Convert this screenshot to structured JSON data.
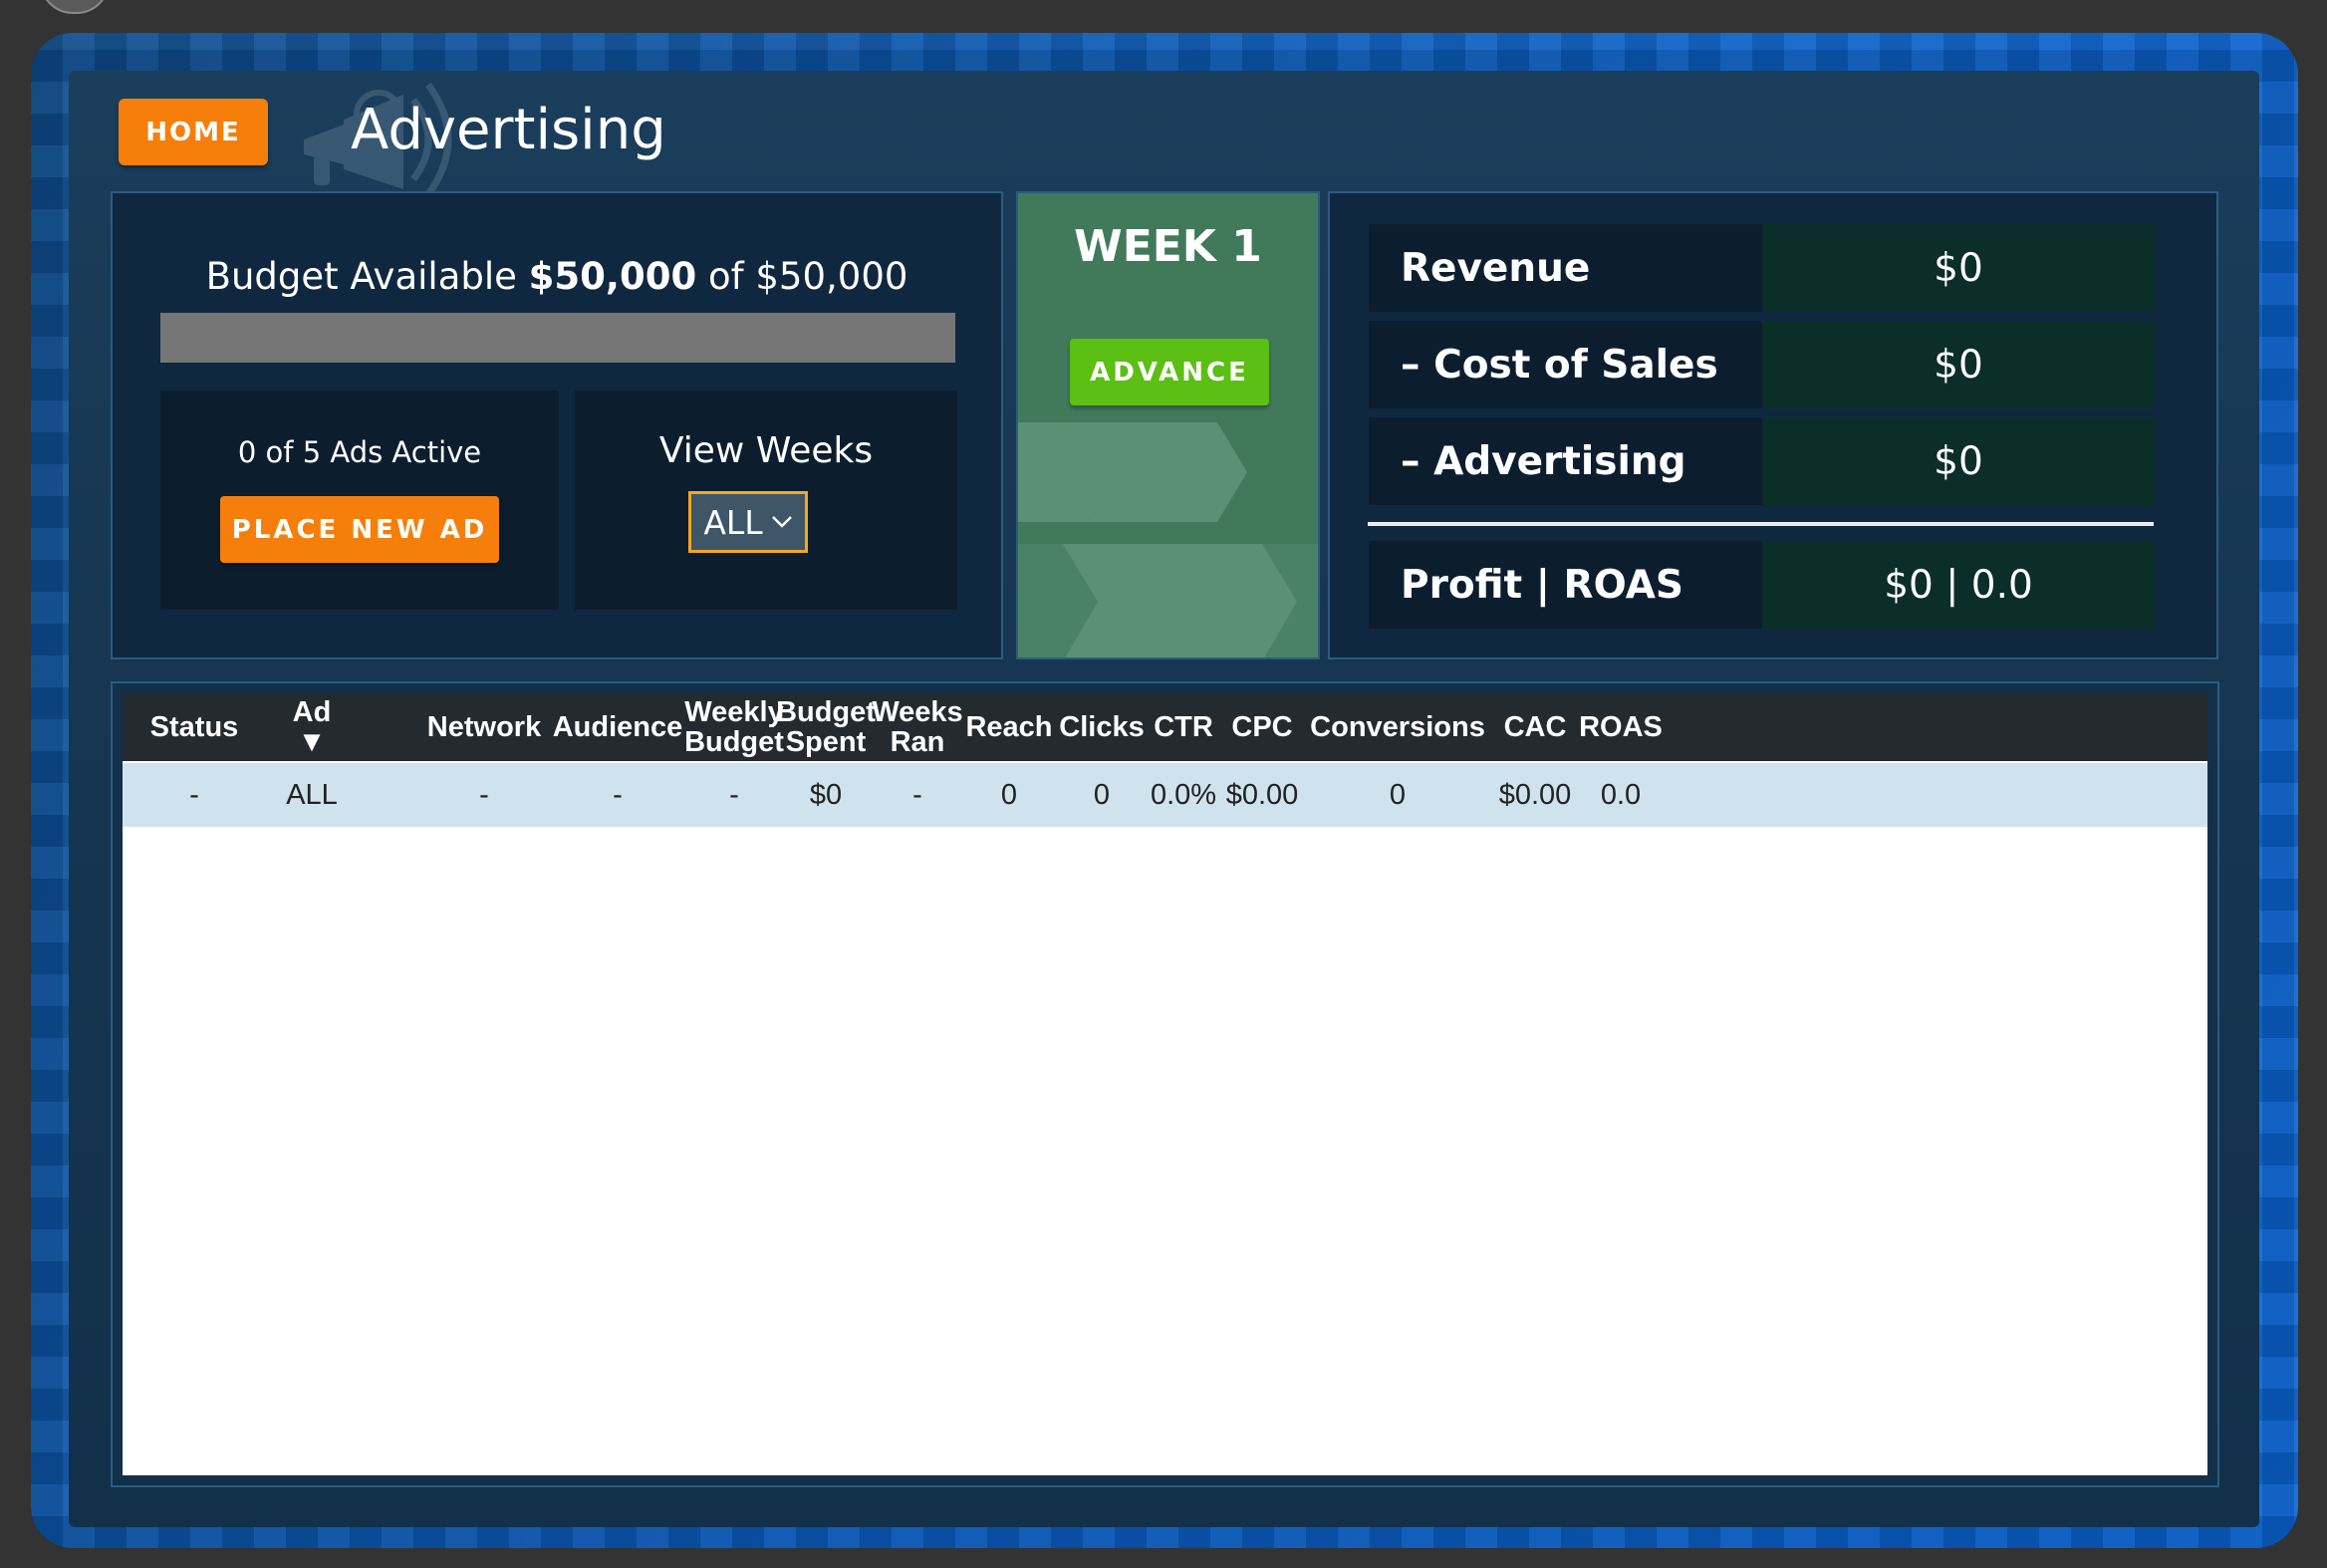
{
  "nav": {
    "home_label": "HOME"
  },
  "page": {
    "title": "Advertising"
  },
  "budget": {
    "prefix": "Budget Available",
    "available": "$50,000",
    "of_text": "of $50,000",
    "spent_fraction": 0
  },
  "ads": {
    "active_text": "0 of 5 Ads Active",
    "place_button_label": "PLACE NEW AD"
  },
  "view_weeks": {
    "label": "View Weeks",
    "selected": "ALL"
  },
  "week": {
    "title": "WEEK 1",
    "advance_label": "ADVANCE"
  },
  "financials": {
    "revenue": {
      "label": "Revenue",
      "value": "$0"
    },
    "cost_of_sales": {
      "label": "– Cost of Sales",
      "value": "$0"
    },
    "advertising": {
      "label": "– Advertising",
      "value": "$0"
    },
    "profit": {
      "label": "Profit | ROAS",
      "value": "$0 | 0.0"
    }
  },
  "table": {
    "columns": [
      "Status",
      "Ad\n▼",
      "Network",
      "Audience",
      "Weekly\nBudget",
      "Budget\nSpent",
      "Weeks\nRan",
      "Reach",
      "Clicks",
      "CTR",
      "CPC",
      "Conversions",
      "CAC",
      "ROAS"
    ],
    "rows": [
      [
        "-",
        "ALL",
        "-",
        "-",
        "-",
        "$0",
        "-",
        "0",
        "0",
        "0.0%",
        "$0.00",
        "0",
        "$0.00",
        "0.0"
      ]
    ]
  },
  "colors": {
    "accent_orange": "#f57f0a",
    "advance_green": "#5cbf14",
    "panel_navy": "#163652",
    "frame_blue": "#0b5fc4"
  }
}
